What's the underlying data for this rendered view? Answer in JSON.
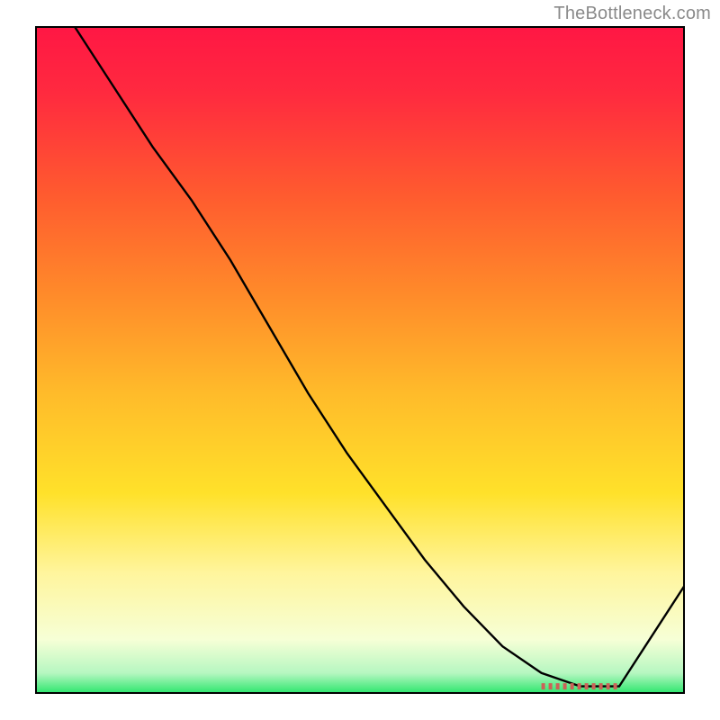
{
  "attribution": "TheBottleneck.com",
  "chart_data": {
    "type": "line",
    "title": "",
    "xlabel": "",
    "ylabel": "",
    "xlim": [
      0,
      100
    ],
    "ylim": [
      0,
      100
    ],
    "grid": false,
    "legend": false,
    "series": [
      {
        "name": "curve",
        "x": [
          6,
          12,
          18,
          24,
          30,
          36,
          42,
          48,
          54,
          60,
          66,
          72,
          78,
          84,
          90,
          94,
          100
        ],
        "y": [
          100,
          91,
          82,
          74,
          65,
          55,
          45,
          36,
          28,
          20,
          13,
          7,
          3,
          1,
          1,
          7,
          16
        ]
      }
    ],
    "flat_segment": {
      "x_start": 78,
      "x_end": 90,
      "y": 1
    },
    "gradient_stops": [
      {
        "offset": 0.0,
        "color": "#ff1744"
      },
      {
        "offset": 0.1,
        "color": "#ff2a3f"
      },
      {
        "offset": 0.25,
        "color": "#ff5a2f"
      },
      {
        "offset": 0.4,
        "color": "#ff8a2a"
      },
      {
        "offset": 0.55,
        "color": "#ffbb2a"
      },
      {
        "offset": 0.7,
        "color": "#ffe12a"
      },
      {
        "offset": 0.82,
        "color": "#fff59d"
      },
      {
        "offset": 0.92,
        "color": "#f6ffd6"
      },
      {
        "offset": 0.97,
        "color": "#b6f7c1"
      },
      {
        "offset": 1.0,
        "color": "#2ee66e"
      }
    ],
    "flat_marker_color": "#cc6258"
  }
}
